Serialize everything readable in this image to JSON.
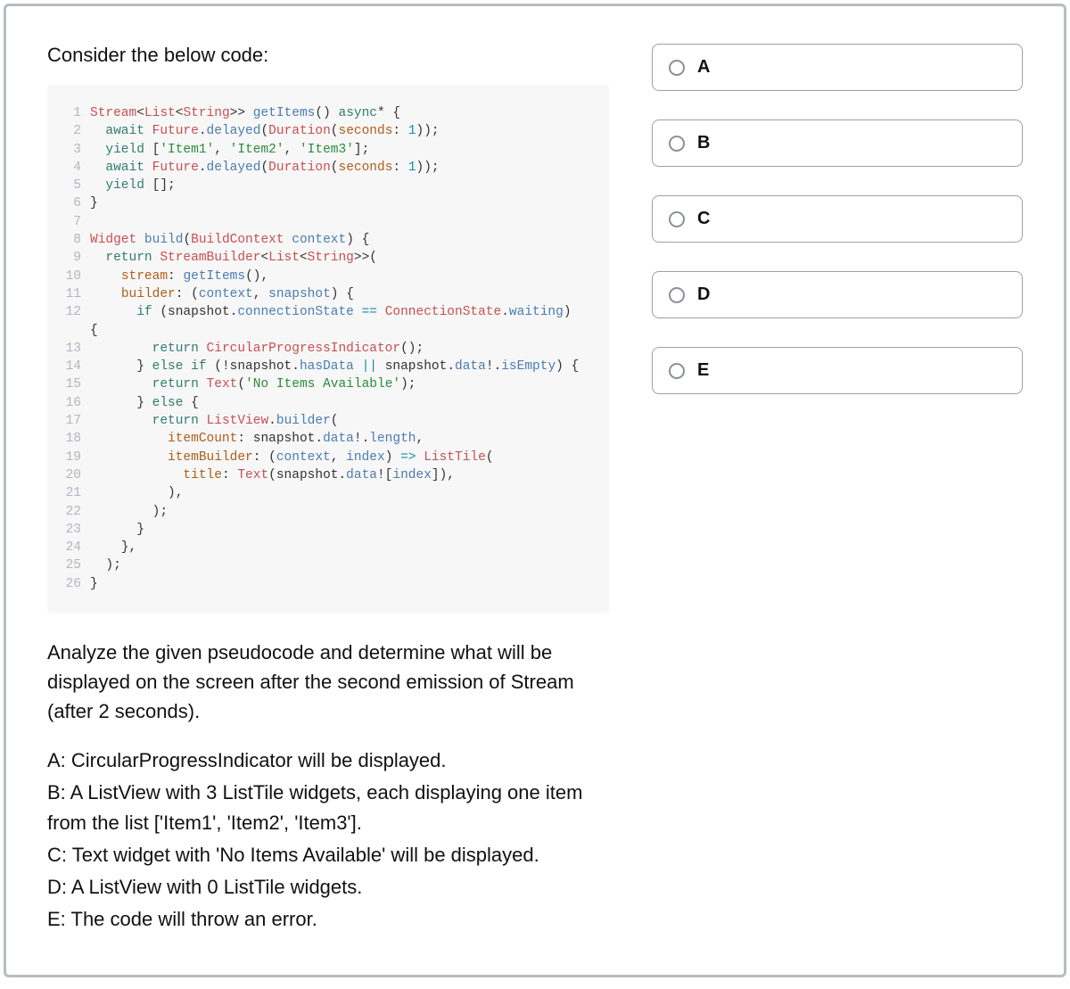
{
  "prompt": "Consider the below code:",
  "code": [
    [
      {
        "t": "type",
        "v": "Stream"
      },
      {
        "t": "punc",
        "v": "<"
      },
      {
        "t": "type",
        "v": "List"
      },
      {
        "t": "punc",
        "v": "<"
      },
      {
        "t": "type",
        "v": "String"
      },
      {
        "t": "punc",
        "v": ">> "
      },
      {
        "t": "fn",
        "v": "getItems"
      },
      {
        "t": "punc",
        "v": "() "
      },
      {
        "t": "kw",
        "v": "async"
      },
      {
        "t": "punc",
        "v": "* {"
      }
    ],
    [
      {
        "t": "punc",
        "v": "  "
      },
      {
        "t": "kw",
        "v": "await"
      },
      {
        "t": "punc",
        "v": " "
      },
      {
        "t": "type",
        "v": "Future"
      },
      {
        "t": "punc",
        "v": "."
      },
      {
        "t": "fn",
        "v": "delayed"
      },
      {
        "t": "punc",
        "v": "("
      },
      {
        "t": "type",
        "v": "Duration"
      },
      {
        "t": "punc",
        "v": "("
      },
      {
        "t": "prop",
        "v": "seconds"
      },
      {
        "t": "punc",
        "v": ": "
      },
      {
        "t": "num",
        "v": "1"
      },
      {
        "t": "punc",
        "v": "));"
      }
    ],
    [
      {
        "t": "punc",
        "v": "  "
      },
      {
        "t": "kw",
        "v": "yield"
      },
      {
        "t": "punc",
        "v": " ["
      },
      {
        "t": "str",
        "v": "'Item1'"
      },
      {
        "t": "punc",
        "v": ", "
      },
      {
        "t": "str",
        "v": "'Item2'"
      },
      {
        "t": "punc",
        "v": ", "
      },
      {
        "t": "str",
        "v": "'Item3'"
      },
      {
        "t": "punc",
        "v": "];"
      }
    ],
    [
      {
        "t": "punc",
        "v": "  "
      },
      {
        "t": "kw",
        "v": "await"
      },
      {
        "t": "punc",
        "v": " "
      },
      {
        "t": "type",
        "v": "Future"
      },
      {
        "t": "punc",
        "v": "."
      },
      {
        "t": "fn",
        "v": "delayed"
      },
      {
        "t": "punc",
        "v": "("
      },
      {
        "t": "type",
        "v": "Duration"
      },
      {
        "t": "punc",
        "v": "("
      },
      {
        "t": "prop",
        "v": "seconds"
      },
      {
        "t": "punc",
        "v": ": "
      },
      {
        "t": "num",
        "v": "1"
      },
      {
        "t": "punc",
        "v": "));"
      }
    ],
    [
      {
        "t": "punc",
        "v": "  "
      },
      {
        "t": "kw",
        "v": "yield"
      },
      {
        "t": "punc",
        "v": " [];"
      }
    ],
    [
      {
        "t": "punc",
        "v": "}"
      }
    ],
    [
      {
        "t": "punc",
        "v": ""
      }
    ],
    [
      {
        "t": "type",
        "v": "Widget"
      },
      {
        "t": "punc",
        "v": " "
      },
      {
        "t": "fn",
        "v": "build"
      },
      {
        "t": "punc",
        "v": "("
      },
      {
        "t": "type",
        "v": "BuildContext"
      },
      {
        "t": "punc",
        "v": " "
      },
      {
        "t": "fn",
        "v": "context"
      },
      {
        "t": "punc",
        "v": ") {"
      }
    ],
    [
      {
        "t": "punc",
        "v": "  "
      },
      {
        "t": "kw",
        "v": "return"
      },
      {
        "t": "punc",
        "v": " "
      },
      {
        "t": "type",
        "v": "StreamBuilder"
      },
      {
        "t": "punc",
        "v": "<"
      },
      {
        "t": "type",
        "v": "List"
      },
      {
        "t": "punc",
        "v": "<"
      },
      {
        "t": "type",
        "v": "String"
      },
      {
        "t": "punc",
        "v": ">>("
      }
    ],
    [
      {
        "t": "punc",
        "v": "    "
      },
      {
        "t": "prop",
        "v": "stream"
      },
      {
        "t": "punc",
        "v": ": "
      },
      {
        "t": "fn",
        "v": "getItems"
      },
      {
        "t": "punc",
        "v": "(),"
      }
    ],
    [
      {
        "t": "punc",
        "v": "    "
      },
      {
        "t": "prop",
        "v": "builder"
      },
      {
        "t": "punc",
        "v": ": ("
      },
      {
        "t": "fn",
        "v": "context"
      },
      {
        "t": "punc",
        "v": ", "
      },
      {
        "t": "fn",
        "v": "snapshot"
      },
      {
        "t": "punc",
        "v": ") {"
      }
    ],
    [
      {
        "t": "punc",
        "v": "      "
      },
      {
        "t": "kw",
        "v": "if"
      },
      {
        "t": "punc",
        "v": " (snapshot."
      },
      {
        "t": "fn",
        "v": "connectionState"
      },
      {
        "t": "punc",
        "v": " "
      },
      {
        "t": "op",
        "v": "=="
      },
      {
        "t": "punc",
        "v": " "
      },
      {
        "t": "type",
        "v": "ConnectionState"
      },
      {
        "t": "punc",
        "v": "."
      },
      {
        "t": "fn",
        "v": "waiting"
      },
      {
        "t": "punc",
        "v": ")"
      },
      {
        "t": "wrap",
        "v": "\n{"
      }
    ],
    [
      {
        "t": "punc",
        "v": "        "
      },
      {
        "t": "kw",
        "v": "return"
      },
      {
        "t": "punc",
        "v": " "
      },
      {
        "t": "type",
        "v": "CircularProgressIndicator"
      },
      {
        "t": "punc",
        "v": "();"
      }
    ],
    [
      {
        "t": "punc",
        "v": "      } "
      },
      {
        "t": "kw",
        "v": "else"
      },
      {
        "t": "punc",
        "v": " "
      },
      {
        "t": "kw",
        "v": "if"
      },
      {
        "t": "punc",
        "v": " (!snapshot."
      },
      {
        "t": "fn",
        "v": "hasData"
      },
      {
        "t": "punc",
        "v": " "
      },
      {
        "t": "op",
        "v": "||"
      },
      {
        "t": "punc",
        "v": " snapshot."
      },
      {
        "t": "fn",
        "v": "data"
      },
      {
        "t": "punc",
        "v": "!."
      },
      {
        "t": "fn",
        "v": "isEmpty"
      },
      {
        "t": "punc",
        "v": ") {"
      }
    ],
    [
      {
        "t": "punc",
        "v": "        "
      },
      {
        "t": "kw",
        "v": "return"
      },
      {
        "t": "punc",
        "v": " "
      },
      {
        "t": "type",
        "v": "Text"
      },
      {
        "t": "punc",
        "v": "("
      },
      {
        "t": "str",
        "v": "'No Items Available'"
      },
      {
        "t": "punc",
        "v": ");"
      }
    ],
    [
      {
        "t": "punc",
        "v": "      } "
      },
      {
        "t": "kw",
        "v": "else"
      },
      {
        "t": "punc",
        "v": " {"
      }
    ],
    [
      {
        "t": "punc",
        "v": "        "
      },
      {
        "t": "kw",
        "v": "return"
      },
      {
        "t": "punc",
        "v": " "
      },
      {
        "t": "type",
        "v": "ListView"
      },
      {
        "t": "punc",
        "v": "."
      },
      {
        "t": "fn",
        "v": "builder"
      },
      {
        "t": "punc",
        "v": "("
      }
    ],
    [
      {
        "t": "punc",
        "v": "          "
      },
      {
        "t": "prop",
        "v": "itemCount"
      },
      {
        "t": "punc",
        "v": ": snapshot."
      },
      {
        "t": "fn",
        "v": "data"
      },
      {
        "t": "punc",
        "v": "!."
      },
      {
        "t": "fn",
        "v": "length"
      },
      {
        "t": "punc",
        "v": ","
      }
    ],
    [
      {
        "t": "punc",
        "v": "          "
      },
      {
        "t": "prop",
        "v": "itemBuilder"
      },
      {
        "t": "punc",
        "v": ": ("
      },
      {
        "t": "fn",
        "v": "context"
      },
      {
        "t": "punc",
        "v": ", "
      },
      {
        "t": "fn",
        "v": "index"
      },
      {
        "t": "punc",
        "v": ") "
      },
      {
        "t": "op",
        "v": "=>"
      },
      {
        "t": "punc",
        "v": " "
      },
      {
        "t": "type",
        "v": "ListTile"
      },
      {
        "t": "punc",
        "v": "("
      }
    ],
    [
      {
        "t": "punc",
        "v": "            "
      },
      {
        "t": "prop",
        "v": "title"
      },
      {
        "t": "punc",
        "v": ": "
      },
      {
        "t": "type",
        "v": "Text"
      },
      {
        "t": "punc",
        "v": "(snapshot."
      },
      {
        "t": "fn",
        "v": "data"
      },
      {
        "t": "punc",
        "v": "!["
      },
      {
        "t": "fn",
        "v": "index"
      },
      {
        "t": "punc",
        "v": "]),"
      }
    ],
    [
      {
        "t": "punc",
        "v": "          ),"
      }
    ],
    [
      {
        "t": "punc",
        "v": "        );"
      }
    ],
    [
      {
        "t": "punc",
        "v": "      }"
      }
    ],
    [
      {
        "t": "punc",
        "v": "    },"
      }
    ],
    [
      {
        "t": "punc",
        "v": "  );"
      }
    ],
    [
      {
        "t": "punc",
        "v": "}"
      }
    ]
  ],
  "question": "Analyze the given pseudocode and determine what will be displayed on the screen after the second emission of Stream (after 2 seconds).",
  "options_text": [
    "A: CircularProgressIndicator will be displayed.",
    "B: A ListView with 3 ListTile widgets, each displaying one item from the list ['Item1', 'Item2', 'Item3'].",
    "C: Text widget with 'No Items Available' will be displayed.",
    "D: A ListView with 0 ListTile widgets.",
    "E: The code will throw an error."
  ],
  "answers": [
    "A",
    "B",
    "C",
    "D",
    "E"
  ]
}
